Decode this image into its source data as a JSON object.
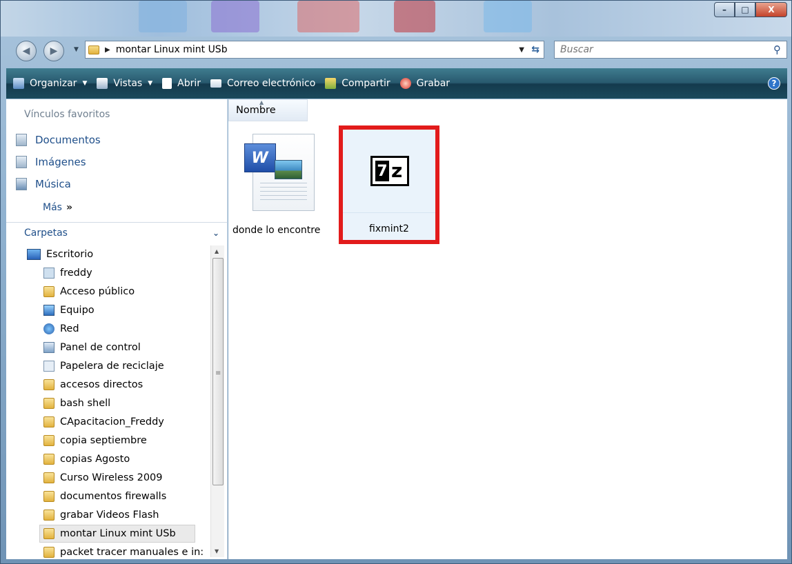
{
  "window": {
    "controls": {
      "minimize": "–",
      "maximize": "□",
      "close": "X"
    }
  },
  "navigation": {
    "back_icon": "back-arrow-icon",
    "forward_icon": "forward-arrow-icon",
    "address": {
      "path": "montar Linux mint USb"
    },
    "search": {
      "placeholder": "Buscar"
    }
  },
  "toolbar": {
    "items": [
      {
        "label": "Organizar",
        "icon": "organize-icon",
        "has_dropdown": true
      },
      {
        "label": "Vistas",
        "icon": "views-icon",
        "has_dropdown": true
      },
      {
        "label": "Abrir",
        "icon": "open-icon",
        "has_dropdown": false
      },
      {
        "label": "Correo electrónico",
        "icon": "email-icon",
        "has_dropdown": false
      },
      {
        "label": "Compartir",
        "icon": "share-icon",
        "has_dropdown": false
      },
      {
        "label": "Grabar",
        "icon": "burn-icon",
        "has_dropdown": false
      }
    ],
    "help": "?"
  },
  "favorites": {
    "title": "Vínculos favoritos",
    "items": [
      {
        "label": "Documentos"
      },
      {
        "label": "Imágenes"
      },
      {
        "label": "Música"
      }
    ],
    "more": "Más",
    "more_arrow": "»"
  },
  "folders": {
    "header": "Carpetas",
    "tree": [
      {
        "label": "Escritorio",
        "icon": "desktop"
      },
      {
        "label": "freddy",
        "icon": "user"
      },
      {
        "label": "Acceso público",
        "icon": "folder"
      },
      {
        "label": "Equipo",
        "icon": "pc"
      },
      {
        "label": "Red",
        "icon": "net"
      },
      {
        "label": "Panel de control",
        "icon": "panel"
      },
      {
        "label": "Papelera de reciclaje",
        "icon": "bin"
      },
      {
        "label": "accesos directos",
        "icon": "folder"
      },
      {
        "label": "bash shell",
        "icon": "folder"
      },
      {
        "label": "CApacitacion_Freddy",
        "icon": "folder"
      },
      {
        "label": "copia septiembre",
        "icon": "folder"
      },
      {
        "label": "copias Agosto",
        "icon": "folder"
      },
      {
        "label": "Curso Wireless 2009",
        "icon": "folder"
      },
      {
        "label": "documentos firewalls",
        "icon": "folder"
      },
      {
        "label": "grabar Videos Flash",
        "icon": "folder"
      },
      {
        "label": "montar Linux mint USb",
        "icon": "folder",
        "selected": true
      },
      {
        "label": "packet tracer manuales e in:",
        "icon": "folder"
      }
    ]
  },
  "content": {
    "column_header": "Nombre",
    "files": [
      {
        "name": "donde lo encontre",
        "type": "word-document"
      },
      {
        "name": "fixmint2",
        "type": "7z-archive",
        "highlighted": true
      }
    ]
  },
  "colors": {
    "toolbar": "#28596e",
    "link": "#1f4f8a",
    "highlight_border": "#e21b1b"
  }
}
